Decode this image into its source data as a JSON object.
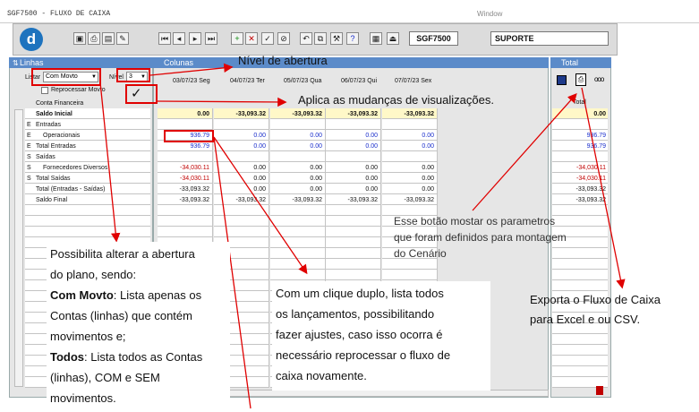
{
  "app": {
    "title": "SGF7500 - FLUXO DE CAIXA",
    "window_menu": "Window",
    "program_code": "SGF7500",
    "user": "SUPORTE"
  },
  "panels": {
    "linhas": "Linhas",
    "colunas": "Colunas",
    "total": "Total"
  },
  "filters": {
    "listar_label": "Listar",
    "listar_value": "Com Movto",
    "nivel_label": "Nível",
    "nivel_value": "3",
    "reprocessar_label": "Reprocessar Movto",
    "apply_mark": "✓",
    "conta_financeira_label": "Conta Financeira"
  },
  "columns": [
    "03/07/23 Seg",
    "04/07/23 Ter",
    "05/07/23 Qua",
    "06/07/23 Qui",
    "07/07/23 Sex"
  ],
  "total_header": "Total",
  "rows": [
    {
      "type": "",
      "label": "Saldo Inicial",
      "values": [
        "0.00",
        "-33,093.32",
        "-33,093.32",
        "-33,093.32",
        "-33,093.32"
      ],
      "total": "0.00"
    },
    {
      "type": "E",
      "label": "Entradas",
      "values": [
        "",
        "",
        "",
        "",
        ""
      ],
      "total": ""
    },
    {
      "type": "E",
      "label": "Operacionais",
      "values": [
        "936.79",
        "0.00",
        "0.00",
        "0.00",
        "0.00"
      ],
      "total": "936.79"
    },
    {
      "type": "E",
      "label": "Total Entradas",
      "values": [
        "936.79",
        "0.00",
        "0.00",
        "0.00",
        "0.00"
      ],
      "total": "936.79"
    },
    {
      "type": "S",
      "label": "Saídas",
      "values": [
        "",
        "",
        "",
        "",
        ""
      ],
      "total": ""
    },
    {
      "type": "S",
      "label": "Fornecedores Diversos",
      "values": [
        "-34,030.11",
        "0.00",
        "0.00",
        "0.00",
        "0.00"
      ],
      "total": "-34,030.11"
    },
    {
      "type": "S",
      "label": "Total Saídas",
      "values": [
        "-34,030.11",
        "0.00",
        "0.00",
        "0.00",
        "0.00"
      ],
      "total": "-34,030.11"
    },
    {
      "type": "",
      "label": "Total (Entradas - Saídas)",
      "values": [
        "-33,093.32",
        "0.00",
        "0.00",
        "0.00",
        "0.00"
      ],
      "total": "-33,093.32"
    },
    {
      "type": "",
      "label": "Saldo Final",
      "values": [
        "-33,093.32",
        "-33,093.32",
        "-33,093.32",
        "-33,093.32",
        "-33,093.32"
      ],
      "total": "-33,093.32"
    }
  ],
  "callouts": {
    "nivel": "Nível de abertura",
    "aplica": "Aplica as mudanças de visualizações.",
    "parametros_1": "Esse botão mostar os parametros",
    "parametros_2": "que foram definidos para montagem",
    "parametros_3": "do Cenário",
    "abertura_1": "Possibilita alterar a abertura",
    "abertura_2": "do plano, sendo:",
    "abertura_3_bold": "Com Movto",
    "abertura_3": ": Lista apenas os",
    "abertura_4": "Contas (linhas) que contém",
    "abertura_5": "movimentos e;",
    "abertura_6_bold": "Todos",
    "abertura_6": ": Lista todos as Contas",
    "abertura_7": "(linhas), COM e SEM",
    "abertura_8": "movimentos.",
    "duplo_1": "Com um clique duplo, lista todos",
    "duplo_2": "os lançamentos, possibilitando",
    "duplo_3": "fazer ajustes, caso isso ocorra é",
    "duplo_4": "necessário reprocessar o fluxo de",
    "duplo_5": "caixa novamente.",
    "exporta_1": "Exporta o Fluxo de Caixa",
    "exporta_2": "para Excel e ou CSV."
  },
  "icons": {
    "toolbar": [
      "save-icon",
      "print-icon",
      "preview-icon",
      "edit-icon",
      "first-icon",
      "prev-icon",
      "next-icon",
      "last-icon",
      "add-icon",
      "delete-icon",
      "confirm-icon",
      "cancel-icon",
      "undo-icon",
      "copy-icon",
      "tools-icon",
      "help-icon",
      "calendar-icon",
      "exit-icon"
    ]
  },
  "colors": {
    "panel_header": "#5b8bc9",
    "highlight_row": "#fff8c8",
    "annotation": "#e00000"
  }
}
